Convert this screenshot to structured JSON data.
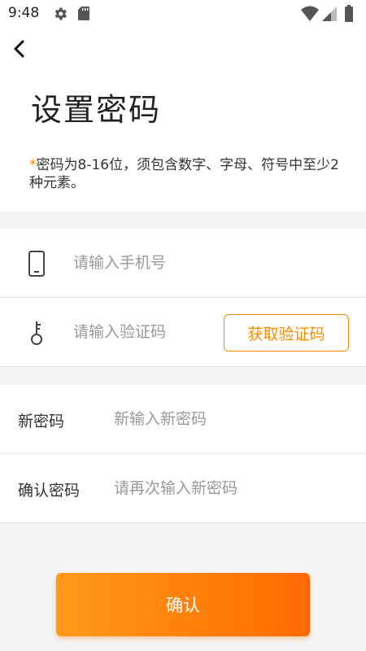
{
  "status_bar": {
    "time": "9:48",
    "icons": [
      "settings-gear-icon",
      "sd-card-icon",
      "wifi-icon",
      "signal-icon",
      "battery-icon"
    ]
  },
  "header": {
    "back_icon": "back-arrow-icon",
    "title": "设置密码",
    "hint_asterisk": "*",
    "hint_text": "密码为8-16位，须包含数字、字母、符号中至少2种元素。"
  },
  "form": {
    "phone": {
      "icon": "phone-icon",
      "placeholder": "请输入手机号",
      "value": ""
    },
    "verification": {
      "icon": "key-icon",
      "placeholder": "请输入验证码",
      "value": "",
      "button_label": "获取验证码"
    },
    "new_password": {
      "label": "新密码",
      "placeholder": "新输入新密码",
      "value": ""
    },
    "confirm_password": {
      "label": "确认密码",
      "placeholder": "请再次输入新密码",
      "value": ""
    }
  },
  "confirm_button": {
    "label": "确认"
  },
  "colors": {
    "accent": "#ff8a00",
    "button_gradient_start": "#ff9a1a",
    "button_gradient_end": "#ff6a00",
    "background": "#f4f4f4"
  }
}
